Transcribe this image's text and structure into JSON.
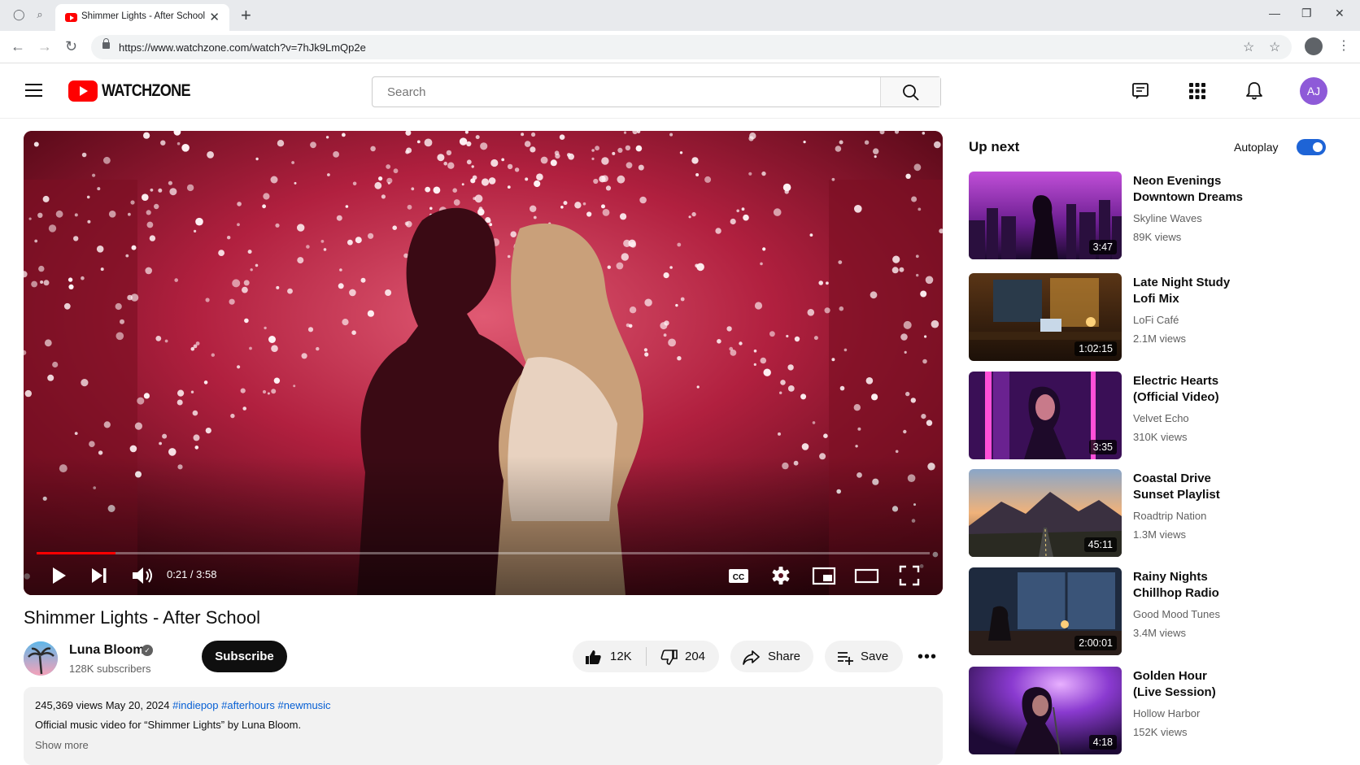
{
  "browser": {
    "tab_title": "Shimmer Lights - After School",
    "url": "https://www.watchzone.com/watch?v=7hJk9LmQp2e"
  },
  "header": {
    "logo_text": "WATCHZONE",
    "search_placeholder": "Search",
    "avatar_initials": "AJ"
  },
  "player": {
    "time": "0:21 / 3:58",
    "progress": 0.088,
    "cc_label": "CC"
  },
  "video": {
    "title": "Shimmer Lights - After School",
    "channel": "Luna Bloom",
    "subscribers": "128K subscribers",
    "subscribe_label": "Subscribe",
    "likes": "12K",
    "dislikes": "204",
    "share_label": "Share",
    "save_label": "Save",
    "views_date": "245,369 views  May 20, 2024",
    "tags": [
      "#indiepop",
      "#afterhours",
      "#newmusic"
    ],
    "description": "Official music video for “Shimmer Lights” by Luna Bloom.",
    "show_more": "Show more"
  },
  "sidebar": {
    "up_next": "Up next",
    "autoplay_label": "Autoplay",
    "autoplay_on": true,
    "items": [
      {
        "title_line1": "Neon Evenings",
        "title_line2": "Downtown Dreams",
        "channel": "Skyline Waves",
        "views": "89K views",
        "duration": "3:47"
      },
      {
        "title_line1": "Late Night Study",
        "title_line2": "Lofi Mix",
        "channel": "LoFi Café",
        "views": "2.1M views",
        "duration": "1:02:15"
      },
      {
        "title_line1": "Electric Hearts",
        "title_line2": "(Official Video)",
        "channel": "Velvet Echo",
        "views": "310K views",
        "duration": "3:35"
      },
      {
        "title_line1": "Coastal Drive",
        "title_line2": "Sunset Playlist",
        "channel": "Roadtrip Nation",
        "views": "1.3M views",
        "duration": "45:11"
      },
      {
        "title_line1": "Rainy Nights",
        "title_line2": "Chillhop Radio",
        "channel": "Good Mood Tunes",
        "views": "3.4M views",
        "duration": "2:00:01"
      },
      {
        "title_line1": "Golden Hour",
        "title_line2": "(Live Session)",
        "channel": "Hollow Harbor",
        "views": "152K views",
        "duration": "4:18"
      }
    ]
  },
  "colors": {
    "brand": "#ff0000",
    "link": "#065fd4",
    "toggle": "#1e64d6",
    "avatar": "#8e5ad8"
  }
}
